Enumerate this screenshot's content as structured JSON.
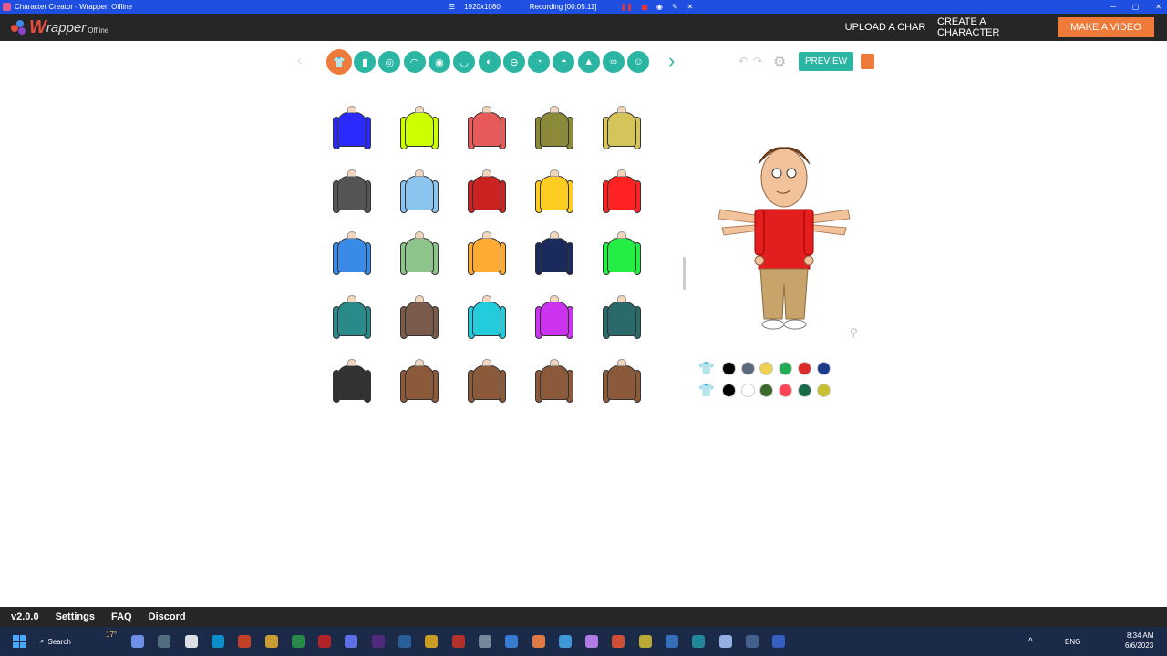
{
  "window": {
    "title": "Character Creator - Wrapper: Offline"
  },
  "recorder": {
    "resolution": "1920x1080",
    "status": "Recording [00:05:11]"
  },
  "app": {
    "logo_text_w": "W",
    "logo_text_rest": "rapper",
    "logo_suffix": "Offline",
    "nav": {
      "upload": "UPLOAD A CHAR",
      "create": "CREATE A CHARACTER",
      "make_video": "MAKE A VIDEO"
    },
    "accent": "#ef7b3b",
    "teal": "#2bb5a3"
  },
  "toolbar": {
    "categories": [
      "upper-body",
      "lower-body",
      "face",
      "hair",
      "head",
      "mouth",
      "eyes",
      "eyebrows",
      "nose",
      "ear",
      "beard",
      "glasses",
      "accessory"
    ],
    "preview_label": "PREVIEW"
  },
  "grid": {
    "rows": [
      [
        "#2a2aff",
        "#ccff00",
        "#e85a5a",
        "#8a8a3a",
        "#d4c45a"
      ],
      [
        "#555555",
        "#8cc4f0",
        "#cc2222",
        "#ffcc22",
        "#ff2222"
      ],
      [
        "#3a8ae8",
        "#8cc48c",
        "#ffaa33",
        "#1a2a5a",
        "#22ee44"
      ],
      [
        "#2a8a8a",
        "#7a5a4a",
        "#22ccdd",
        "#cc33ee",
        "#2a6a6a"
      ],
      [
        "#333333",
        "#8a5a3a",
        "#8a5a3a",
        "#8a5a3a",
        "#8a5a3a"
      ]
    ]
  },
  "palette": {
    "row1": [
      "#000000",
      "#5a6a7a",
      "#f0d050",
      "#22aa55",
      "#dd2a2a",
      "#1a3a8a"
    ],
    "row2": [
      "#000000",
      "#ffffff",
      "#3a6a2a",
      "#ff4455",
      "#1a6a4a",
      "#c8c030"
    ]
  },
  "footer": {
    "version": "v2.0.0",
    "settings": "Settings",
    "faq": "FAQ",
    "discord": "Discord"
  },
  "taskbar": {
    "search": "Search",
    "weather": "17°",
    "lang": "ENG",
    "time": "8:34 AM",
    "date": "6/6/2023"
  }
}
